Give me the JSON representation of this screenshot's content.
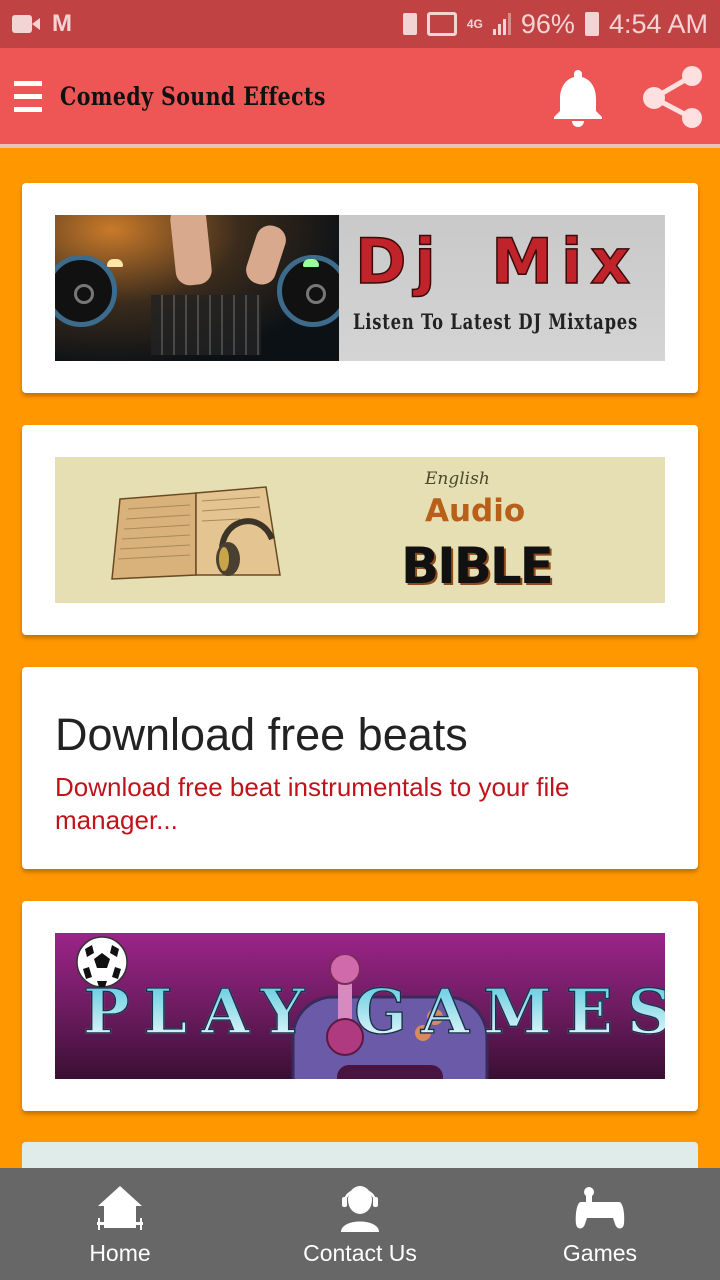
{
  "status_bar": {
    "left_icons": [
      "video-camera-icon",
      "gmail-icon"
    ],
    "right_icons": [
      "battery-saver-icon",
      "cast-icon",
      "network-4g-icon",
      "signal-icon"
    ],
    "network": "4G",
    "battery": "96%",
    "time": "4:54 AM"
  },
  "app_bar": {
    "title": "Comedy Sound Effects",
    "menu_icon": "menu-icon",
    "actions": [
      "bell-icon",
      "share-icon"
    ]
  },
  "colors": {
    "status_bar": "#c14243",
    "app_bar": "#ee5555",
    "background": "#ff9800",
    "card": "#ffffff",
    "accent_text": "#c0141b",
    "bottom_nav": "#676767"
  },
  "cards": [
    {
      "type": "banner",
      "title": "Dj Mix",
      "subtitle": "Listen To Latest DJ Mixtapes"
    },
    {
      "type": "banner",
      "pre_title": "English",
      "title": "Audio",
      "subtitle": "BIBLE"
    },
    {
      "type": "text",
      "title": "Download free beats",
      "description": "Download free beat instrumentals to your file manager..."
    },
    {
      "type": "banner",
      "title": "PLAY GAMES"
    }
  ],
  "bottom_nav": {
    "items": [
      {
        "label": "Home",
        "icon": "home-icon"
      },
      {
        "label": "Contact Us",
        "icon": "headset-person-icon"
      },
      {
        "label": "Games",
        "icon": "gamepad-icon"
      }
    ]
  }
}
